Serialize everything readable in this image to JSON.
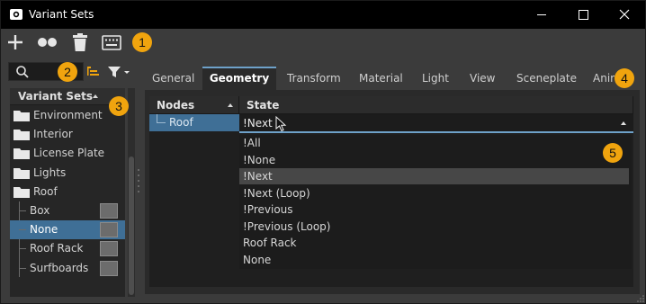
{
  "window": {
    "title": "Variant Sets"
  },
  "toolbar": {
    "buttons": [
      "add-icon",
      "variant-icon",
      "delete-icon",
      "keyboard-icon"
    ]
  },
  "callouts": [
    "1",
    "2",
    "3",
    "4",
    "5"
  ],
  "tree": {
    "header": "Variant Sets",
    "items": [
      {
        "label": "Environment",
        "kind": "folder"
      },
      {
        "label": "Interior",
        "kind": "folder"
      },
      {
        "label": "License Plate",
        "kind": "folder"
      },
      {
        "label": "Lights",
        "kind": "folder"
      },
      {
        "label": "Roof",
        "kind": "folder"
      },
      {
        "label": "Box",
        "kind": "variant"
      },
      {
        "label": "None",
        "kind": "variant",
        "selected": true
      },
      {
        "label": "Roof Rack",
        "kind": "variant"
      },
      {
        "label": "Surfboards",
        "kind": "variant"
      }
    ]
  },
  "tabs": [
    "General",
    "Geometry",
    "Transform",
    "Material",
    "Light",
    "View",
    "Sceneplate",
    "Anir"
  ],
  "active_tab": "Geometry",
  "table": {
    "headers": {
      "nodes": "Nodes",
      "state": "State"
    },
    "node": "Roof",
    "state_value": "!Next"
  },
  "dropdown": {
    "options": [
      "!All",
      "!None",
      "!Next",
      "!Next (Loop)",
      "!Previous",
      "!Previous (Loop)",
      "Roof Rack",
      "None"
    ],
    "highlighted": "!Next"
  },
  "colors": {
    "accent": "#6ea1c9",
    "selection": "#3f6f96",
    "badge": "#f0a40e"
  }
}
